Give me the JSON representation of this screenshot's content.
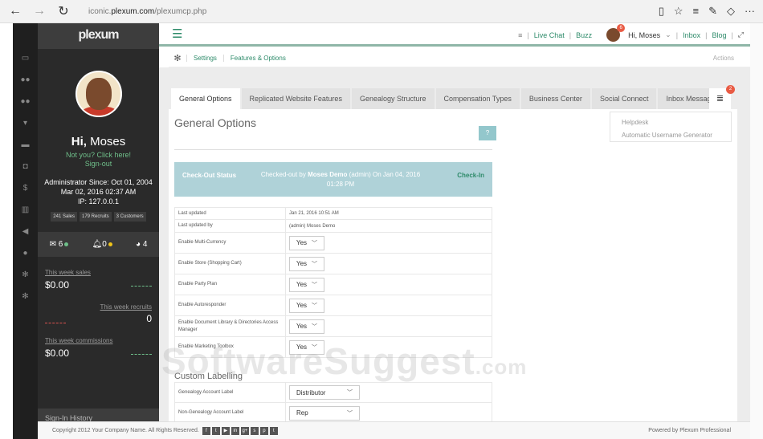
{
  "browser": {
    "url_prefix": "iconic.",
    "url_domain": "plexum.com",
    "url_path": "/plexumcp.php"
  },
  "brand": {
    "logo_text": "plexum"
  },
  "sidebar": {
    "greeting_prefix": "Hi,",
    "user_name": "Moses",
    "not_you": "Not you? Click here!",
    "sign_out": "Sign-out",
    "admin_since": "Administrator Since: Oct 01, 2004",
    "last_login": "Mar 02, 2016 02:37 AM",
    "ip": "IP: 127.0.0.1",
    "stats": [
      "241 Sales",
      "179 Recruits",
      "3 Customers"
    ],
    "messages_count": "6",
    "alerts_count": "0",
    "globe_count": "4",
    "week_sales_label": "This week sales",
    "week_sales_value": "$0.00",
    "week_recruits_label": "This week recruits",
    "week_recruits_value": "0",
    "week_commissions_label": "This week commissions",
    "week_commissions_value": "$0.00",
    "signin_history": "Sign-In History",
    "colors": {
      "accent_green": "#6fbf8a",
      "accent_red": "#d9534f",
      "accent_yellow": "#f0c419"
    }
  },
  "topbar": {
    "live_chat": "Live Chat",
    "buzz": "Buzz",
    "user_greeting": "Hi, Moses",
    "user_badge": "6",
    "inbox": "Inbox",
    "blog": "Blog"
  },
  "breadcrumb": {
    "settings": "Settings",
    "features": "Features & Options",
    "actions": "Actions"
  },
  "tabs": [
    "General Options",
    "Replicated Website Features",
    "Genealogy Structure",
    "Compensation Types",
    "Business Center",
    "Social Connect",
    "Inbox Messages"
  ],
  "tab_badge": "2",
  "dropdown_menu": [
    "Helpdesk",
    "Automatic Username Generator"
  ],
  "main": {
    "title": "General Options",
    "help": "?",
    "checkout": {
      "label": "Check-Out Status",
      "text_prefix": "Checked-out by",
      "text_user": "Moses Demo",
      "text_suffix": "(admin) On Jan 04, 2016 01:28 PM",
      "button": "Check-In"
    },
    "last_updated_label": "Last updated",
    "last_updated_value": "Jan 21, 2016 10:51 AM",
    "last_updated_by_label": "Last updated by",
    "last_updated_by_value": "(admin) Moses Demo",
    "options": [
      {
        "label": "Enable Multi-Currency",
        "value": "Yes"
      },
      {
        "label": "Enable Store (Shopping Cart)",
        "value": "Yes"
      },
      {
        "label": "Enable Party Plan",
        "value": "Yes"
      },
      {
        "label": "Enable Autoresponder",
        "value": "Yes"
      },
      {
        "label": "Enable Document Library & Directories Access Manager",
        "value": "Yes"
      },
      {
        "label": "Enable Marketing Toolbox",
        "value": "Yes"
      }
    ],
    "custom_labelling_title": "Custom Labelling",
    "custom_labels": [
      {
        "label": "Genealogy Account Label",
        "value": "Distributor"
      },
      {
        "label": "Non-Genealogy Account Label",
        "value": "Rep"
      }
    ]
  },
  "watermark": {
    "main": "SoftwareSuggest",
    "suffix": ".com"
  },
  "footer": {
    "copyright": "Copyright 2012 Your Company Name. All Rights Reserved.",
    "social": [
      "f",
      "t",
      "▶",
      "in",
      "g+",
      "s",
      "p",
      "t"
    ],
    "powered_by": "Powered by Plexum Professional"
  }
}
